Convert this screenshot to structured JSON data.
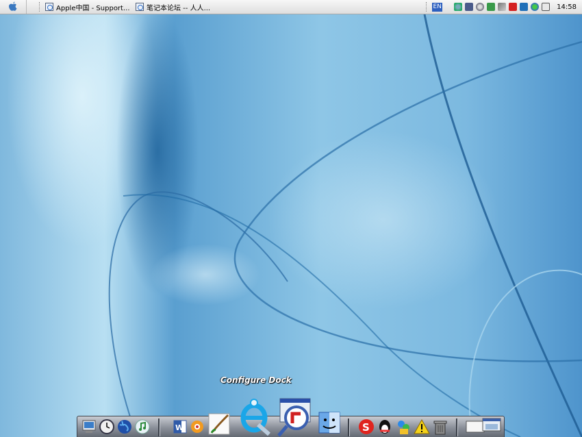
{
  "menubar": {
    "apple_icon": "apple-logo-icon",
    "tasks": [
      {
        "label": "Apple中国 - Support...",
        "icon": "ie-page-icon"
      },
      {
        "label": "笔记本论坛 -- 人人...",
        "icon": "ie-page-icon"
      }
    ],
    "language": "EN",
    "tray_icons": [
      "network-icon",
      "monitor-icon",
      "speaker-icon",
      "shield-icon",
      "phone-icon",
      "kaspersky-icon",
      "download-icon",
      "messenger-icon",
      "window-icon"
    ],
    "clock": "14:58"
  },
  "dock": {
    "tooltip": "Configure Dock",
    "items": [
      "system-monitor-icon",
      "clock-icon",
      "globe-icon",
      "itunes-icon",
      "word-icon",
      "foxmail-icon",
      "paintbrush-icon",
      "ie-browser-icon",
      "flashget-icon",
      "finder-icon",
      "sogou-icon",
      "qq-icon",
      "messenger-app-icon",
      "warning-icon",
      "trash-icon",
      "desktop-windows-icon"
    ]
  },
  "colors": {
    "wallpaper_light": "#bfe3f4",
    "wallpaper_dark": "#1f6ea8",
    "dock_bg": "#8a8f99"
  }
}
